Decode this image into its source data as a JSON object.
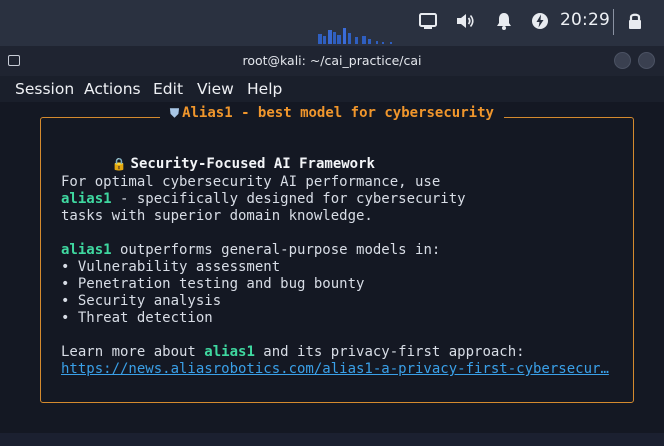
{
  "top_panel": {
    "clock": "20:29",
    "icons": [
      "screen-icon",
      "volume-icon",
      "bell-icon",
      "power-icon",
      "lock-icon"
    ]
  },
  "window": {
    "title": "root@kali: ~/cai_practice/cai"
  },
  "menubar": {
    "items": [
      "Session",
      "Actions",
      "Edit",
      "View",
      "Help"
    ]
  },
  "panel": {
    "title": "Alias1 - best model for cybersecurity",
    "heading": "Security-Focused AI Framework",
    "para1_line1": "For optimal cybersecurity AI performance, use",
    "para1_line2_hl": "alias1",
    "para1_line2_rest": " - specifically designed for cybersecurity",
    "para1_line3": "tasks with superior domain knowledge.",
    "para2_hl": "alias1",
    "para2_rest": " outperforms general-purpose models in:",
    "bullets": [
      "• Vulnerability assessment",
      "• Penetration testing and bug bounty",
      "• Security analysis",
      "• Threat detection"
    ],
    "learn_prefix": "Learn more about ",
    "learn_hl": "alias1",
    "learn_suffix": " and its privacy-first approach:",
    "link": "https://news.aliasrobotics.com/alias1-a-privacy-first-cybersecur…"
  },
  "colors": {
    "accent_orange": "#f0962c",
    "highlight_green": "#3fd8a0",
    "link_blue": "#3aa0e8",
    "terminal_bg": "#141823"
  }
}
